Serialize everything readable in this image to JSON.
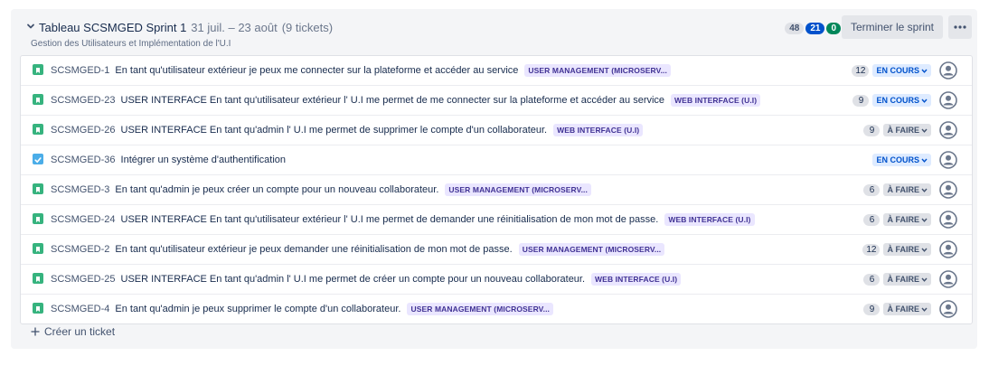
{
  "sprint": {
    "title": "Tableau SCSMGED Sprint 1",
    "dates": "31 juil. – 23 août",
    "ticket_count": "(9 tickets)",
    "goal": "Gestion des Utilisateurs et Implémentation de l'U.I",
    "points_todo": "48",
    "points_in_progress": "21",
    "points_done": "0",
    "finish_label": "Terminer le sprint",
    "more_icon": "more-horizontal-icon",
    "colors": {
      "todo": "#dfe1e6",
      "in_progress": "#0052cc",
      "done": "#00875a",
      "epic_bg": "#eae6ff",
      "epic_text": "#403294"
    }
  },
  "issues": [
    {
      "type": "story",
      "key": "SCSMGED-1",
      "summary": "En tant qu'utilisateur extérieur je peux me connecter sur la plateforme et accéder au service",
      "epic": "USER MANAGEMENT (MICROSERV...",
      "points": "12",
      "status": "EN COURS",
      "status_kind": "prog"
    },
    {
      "type": "story",
      "key": "SCSMGED-23",
      "summary": "USER INTERFACE En tant qu'utilisateur extérieur l' U.I me permet de me connecter sur la plateforme et accéder au service",
      "epic": "WEB INTERFACE (U.I)",
      "points": "9",
      "status": "EN COURS",
      "status_kind": "prog"
    },
    {
      "type": "story",
      "key": "SCSMGED-26",
      "summary": "USER INTERFACE En tant qu'admin l' U.I me permet de supprimer le compte d'un collaborateur.",
      "epic": "WEB INTERFACE (U.I)",
      "points": "9",
      "status": "À FAIRE",
      "status_kind": "todo"
    },
    {
      "type": "task",
      "key": "SCSMGED-36",
      "summary": "Intégrer un système d'authentification",
      "epic": "",
      "points": "",
      "status": "EN COURS",
      "status_kind": "prog"
    },
    {
      "type": "story",
      "key": "SCSMGED-3",
      "summary": "En tant qu'admin je peux créer un compte pour un nouveau collaborateur.",
      "epic": "USER MANAGEMENT (MICROSERV...",
      "points": "6",
      "status": "À FAIRE",
      "status_kind": "todo"
    },
    {
      "type": "story",
      "key": "SCSMGED-24",
      "summary": "USER INTERFACE En tant qu'utilisateur extérieur l' U.I me permet de demander une réinitialisation de mon mot de passe.",
      "epic": "WEB INTERFACE (U.I)",
      "points": "6",
      "status": "À FAIRE",
      "status_kind": "todo"
    },
    {
      "type": "story",
      "key": "SCSMGED-2",
      "summary": "En tant qu'utilisateur extérieur je peux demander une réinitialisation de mon mot de passe.",
      "epic": "USER MANAGEMENT (MICROSERV...",
      "points": "12",
      "status": "À FAIRE",
      "status_kind": "todo"
    },
    {
      "type": "story",
      "key": "SCSMGED-25",
      "summary": "USER INTERFACE En tant qu'admin l' U.I me permet de créer un compte pour un nouveau collaborateur.",
      "epic": "WEB INTERFACE (U.I)",
      "points": "6",
      "status": "À FAIRE",
      "status_kind": "todo"
    },
    {
      "type": "story",
      "key": "SCSMGED-4",
      "summary": "En tant qu'admin je peux supprimer le compte d'un collaborateur.",
      "epic": "USER MANAGEMENT (MICROSERV...",
      "points": "9",
      "status": "À FAIRE",
      "status_kind": "todo"
    }
  ],
  "create_label": "Créer un ticket"
}
